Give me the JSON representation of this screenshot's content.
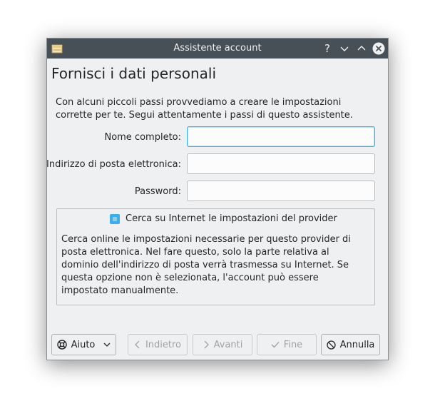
{
  "window": {
    "title": "Assistente account",
    "help_symbol": "?"
  },
  "page": {
    "heading": "Fornisci i dati personali",
    "intro": "Con alcuni piccoli passi provvediamo a creare le impostazioni corrette per te. Segui attentamente i passi di questo assistente."
  },
  "form": {
    "name_label": "Nome completo:",
    "name_value": "",
    "email_label": "Indirizzo di posta elettronica:",
    "email_value": "",
    "password_label": "Password:",
    "password_value": ""
  },
  "provider_group": {
    "checkbox_label": "Cerca su Internet le impostazioni del provider",
    "checked": true,
    "description": "Cerca online le impostazioni necessarie per questo provider di posta elettronica. Nel fare questo, solo la parte relativa al dominio dell'indirizzo di posta verrà trasmessa su Internet. Se questa opzione non è selezionata, l'account può essere impostato manualmente."
  },
  "buttons": {
    "help": "Aiuto",
    "back": "Indietro",
    "next": "Avanti",
    "finish": "Fine",
    "cancel": "Annulla"
  },
  "colors": {
    "titlebar": "#475057",
    "accent": "#3daee9",
    "window_bg": "#eff0f1"
  }
}
